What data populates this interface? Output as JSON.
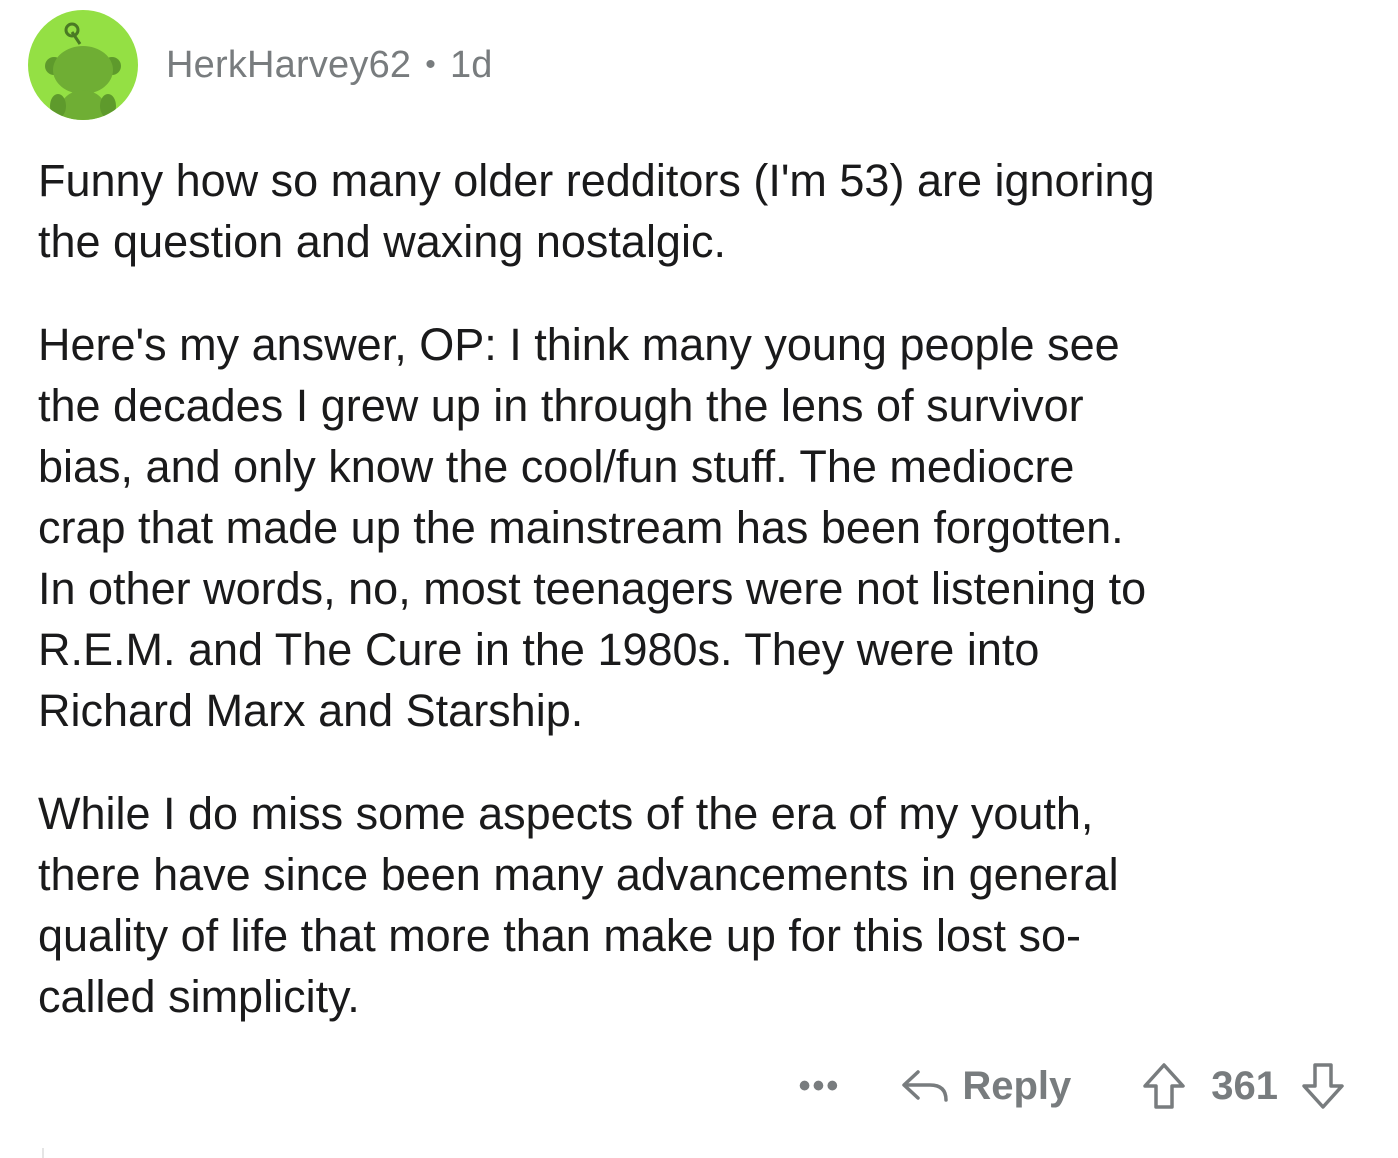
{
  "comment": {
    "author": "HerkHarvey62",
    "separator": "•",
    "age": "1d",
    "paragraphs": [
      {
        "lines": [
          "Funny how so many older redditors (I'm 53) are ignoring",
          "the question and waxing nostalgic."
        ]
      },
      {
        "lines": [
          "Here's my answer, OP: I think many young people see",
          "the decades I grew up in through the lens of survivor",
          "bias, and only know the cool/fun stuff. The mediocre",
          "crap that made up the mainstream has been forgotten.",
          "In other words, no, most teenagers were not listening to",
          "R.E.M. and The Cure in the 1980s. They were into",
          "Richard Marx and Starship."
        ]
      },
      {
        "lines": [
          "While I do miss some aspects of the era of my youth,",
          "there have since been many advancements in general",
          "quality of life that more than make up for this lost so-",
          "called simplicity."
        ]
      }
    ],
    "actions": {
      "more_label": "•••",
      "reply_label": "Reply",
      "score": "361"
    },
    "icons": {
      "avatar": "snoo-avatar-icon",
      "more": "more-options-icon",
      "reply": "reply-arrow-icon",
      "upvote": "upvote-arrow-icon",
      "downvote": "downvote-arrow-icon"
    },
    "colors": {
      "avatar_bg": "#94e044",
      "meta_text": "#787c7e",
      "body_text": "#1a1a1b"
    }
  }
}
